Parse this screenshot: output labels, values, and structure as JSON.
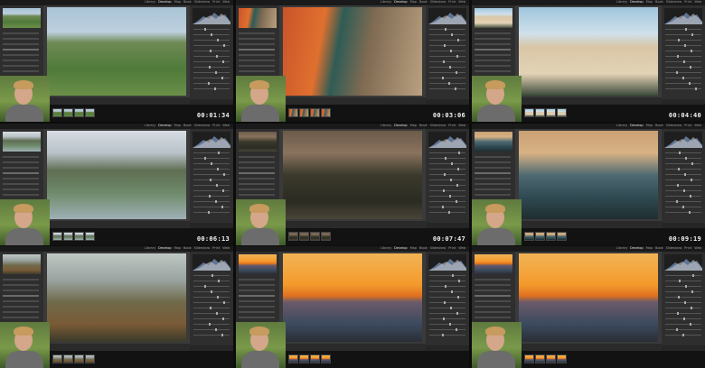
{
  "app": {
    "modules": [
      "Library",
      "Develop",
      "Map",
      "Book",
      "Slideshow",
      "Print",
      "Web"
    ],
    "active_module": "Develop"
  },
  "tiles": [
    {
      "timecode": "00:01:34",
      "photo": "boy-hill-green",
      "nav": "boy-hill-green"
    },
    {
      "timecode": "00:03:06",
      "photo": "girl-orange-van",
      "nav": "girl-orange-van"
    },
    {
      "timecode": "00:04:40",
      "photo": "handstand-beach",
      "nav": "handstand-beach"
    },
    {
      "timecode": "00:06:13",
      "photo": "orange-phone-lake",
      "nav": "orange-phone-lake"
    },
    {
      "timecode": "00:07:47",
      "photo": "hollywood-sign-dusk",
      "nav": "hollywood-sign-dusk"
    },
    {
      "timecode": "00:09:19",
      "photo": "city-overlook-sunset",
      "nav": "city-overlook-sunset"
    },
    {
      "timecode": "",
      "photo": "mountain-branches",
      "nav": "mountain-branches"
    },
    {
      "timecode": "",
      "photo": "ocean-sunset",
      "nav": "ocean-sunset"
    },
    {
      "timecode": "",
      "photo": "ocean-sunset",
      "nav": "ocean-sunset"
    }
  ],
  "colors": {
    "panel": "#2e2e2e",
    "canvas": "#3a3a3a",
    "timecode_text": "#f2f2f2"
  }
}
